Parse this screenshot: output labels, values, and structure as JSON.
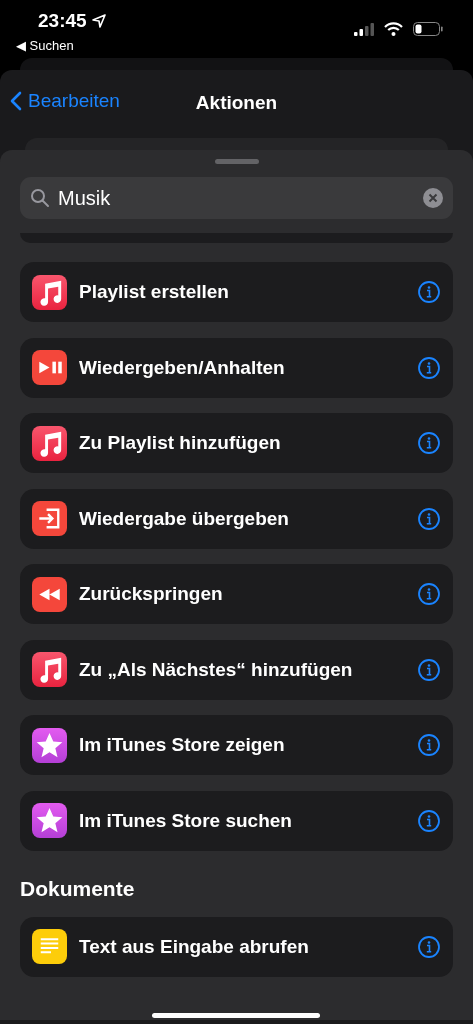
{
  "status_bar": {
    "time": "23:45",
    "back_link": "◀ Suchen"
  },
  "nav": {
    "back": "Bearbeiten",
    "title": "Aktionen"
  },
  "search": {
    "value": "Musik"
  },
  "sections": [
    {
      "items": [
        {
          "kind": "music",
          "label": "Playlist erstellen"
        },
        {
          "kind": "playpause",
          "label": "Wiedergeben/Anhalten"
        },
        {
          "kind": "music",
          "label": "Zu Playlist hinzufügen"
        },
        {
          "kind": "handoff",
          "label": "Wiedergabe übergeben"
        },
        {
          "kind": "rewind",
          "label": "Zurückspringen"
        },
        {
          "kind": "music",
          "label": "Zu „Als Nächstes“ hinzufügen"
        },
        {
          "kind": "star",
          "label": "Im iTunes Store zeigen"
        },
        {
          "kind": "star",
          "label": "Im iTunes Store suchen"
        }
      ]
    },
    {
      "title": "Dokumente",
      "items": [
        {
          "kind": "document",
          "label": "Text aus Eingabe abrufen"
        }
      ]
    }
  ]
}
